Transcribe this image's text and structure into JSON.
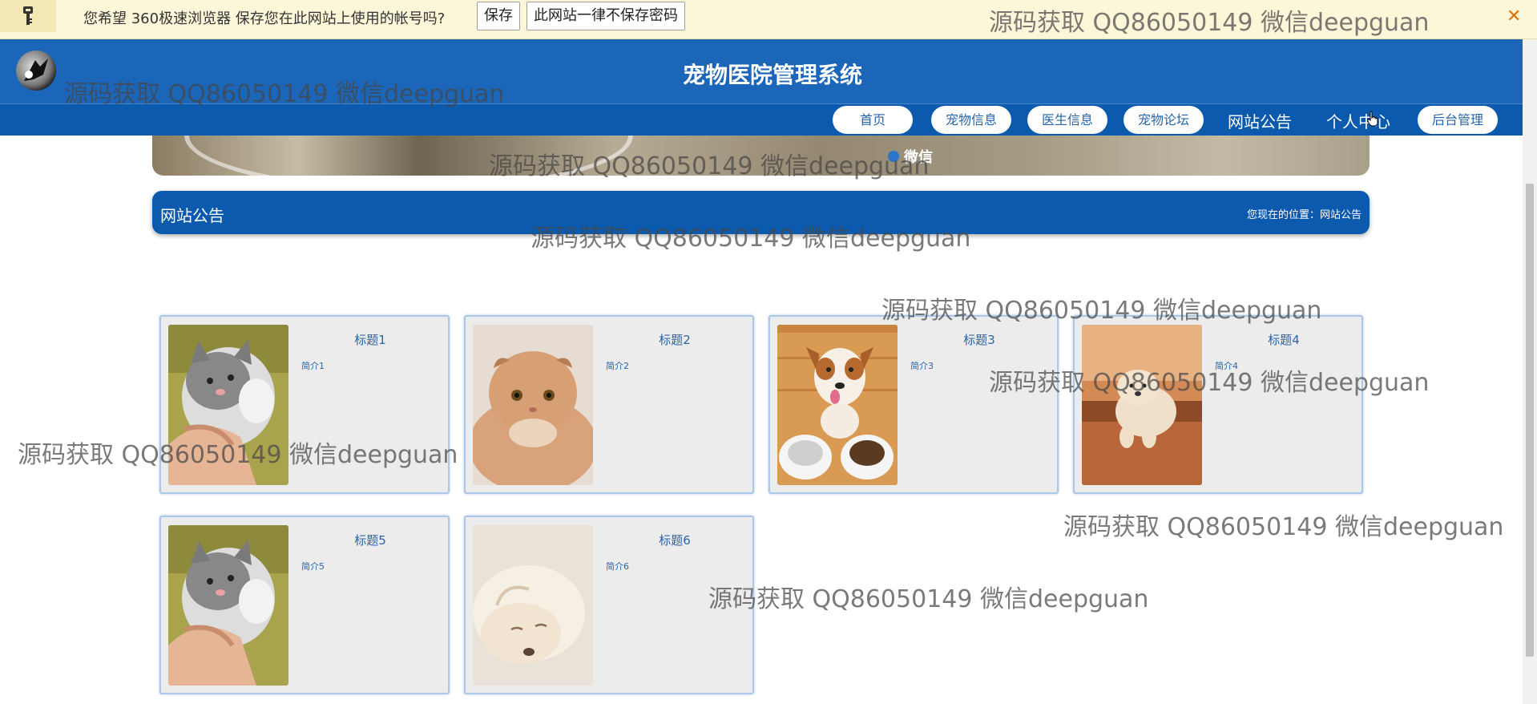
{
  "password_bar": {
    "message": "您希望 360极速浏览器 保存您在此网站上使用的帐号吗?",
    "save_label": "保存",
    "never_label": "此网站一律不保存密码",
    "close_glyph": "✕"
  },
  "header": {
    "site_title": "宠物医院管理系统"
  },
  "nav": {
    "items": [
      {
        "label": "首页"
      },
      {
        "label": "宠物信息"
      },
      {
        "label": "医生信息"
      },
      {
        "label": "宠物论坛"
      },
      {
        "label": "网站公告"
      },
      {
        "label": "个人中心"
      },
      {
        "label": "后台管理"
      }
    ]
  },
  "banner": {
    "caption": "微信"
  },
  "section": {
    "title": "网站公告",
    "location": "您现在的位置：网站公告"
  },
  "cards": [
    {
      "title": "标题1",
      "desc": "简介1",
      "image": "cat-held-by-hand"
    },
    {
      "title": "标题2",
      "desc": "简介2",
      "image": "orange-scottish-fold-cat"
    },
    {
      "title": "标题3",
      "desc": "简介3",
      "image": "dog-with-bowls"
    },
    {
      "title": "标题4",
      "desc": "简介4",
      "image": "puppy-on-stairs"
    },
    {
      "title": "标题5",
      "desc": "简介5",
      "image": "cat-held-by-hand"
    },
    {
      "title": "标题6",
      "desc": "简介6",
      "image": "sleeping-white-puppy"
    }
  ],
  "watermark": "源码获取 QQ86050149 微信deepguan",
  "colors": {
    "brand_blue": "#1b66b8",
    "nav_blue": "#0c5aad",
    "link_blue": "#2a64a8",
    "card_bg": "#ececec"
  }
}
